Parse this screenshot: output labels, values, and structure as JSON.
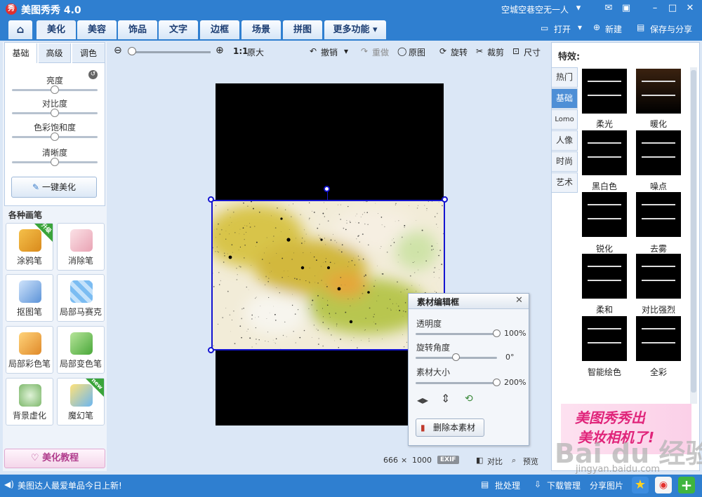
{
  "app": {
    "title": "美图秀秀 4.0",
    "logo_char": "秀"
  },
  "account": {
    "name": "空城空巷空无一人"
  },
  "tabs": [
    {
      "label": "美化"
    },
    {
      "label": "美容"
    },
    {
      "label": "饰品"
    },
    {
      "label": "文字"
    },
    {
      "label": "边框"
    },
    {
      "label": "场景"
    },
    {
      "label": "拼图"
    },
    {
      "label": "更多功能 ▾"
    }
  ],
  "top_actions": {
    "open": "打开",
    "new": "新建",
    "save_share": "保存与分享"
  },
  "left": {
    "subtabs": [
      "基础",
      "高级",
      "调色"
    ],
    "sliders": [
      {
        "label": "亮度",
        "level": 0.5
      },
      {
        "label": "对比度",
        "level": 0.5
      },
      {
        "label": "色彩饱和度",
        "level": 0.5
      },
      {
        "label": "清晰度",
        "level": 0.5
      }
    ],
    "one_click": "一键美化",
    "brushes_title": "各种画笔",
    "brushes": [
      {
        "label": "涂鸦笔",
        "badge": "升级"
      },
      {
        "label": "消除笔",
        "badge": ""
      },
      {
        "label": "抠图笔",
        "badge": ""
      },
      {
        "label": "局部马赛克",
        "badge": ""
      },
      {
        "label": "局部彩色笔",
        "badge": ""
      },
      {
        "label": "局部变色笔",
        "badge": ""
      },
      {
        "label": "背景虚化",
        "badge": ""
      },
      {
        "label": "魔幻笔",
        "badge": "new"
      }
    ],
    "tutorial": "美化教程"
  },
  "toolbar": {
    "ratio": "1:1",
    "original_size": "原大",
    "undo": "撤销",
    "redo": "重做",
    "original": "原图",
    "rotate": "旋转",
    "crop": "裁剪",
    "size": "尺寸"
  },
  "editor": {
    "title": "素材编辑框",
    "opacity_label": "透明度",
    "opacity_value": "100%",
    "opacity_level": 1.0,
    "rotation_label": "旋转角度",
    "rotation_value": "0°",
    "rotation_level": 0.5,
    "size_label": "素材大小",
    "size_value": "200%",
    "size_level": 1.0,
    "delete": "删除本素材"
  },
  "right": {
    "title": "特效:",
    "categories": [
      "热门",
      "基础",
      "Lomo",
      "人像",
      "时尚",
      "艺术"
    ],
    "effects": [
      "柔光",
      "暖化",
      "黑白色",
      "噪点",
      "锐化",
      "去雾",
      "柔和",
      "对比强烈",
      "智能绘色",
      "全彩"
    ],
    "ad_line1": "美图秀秀出",
    "ad_line2": "美妆相机了!"
  },
  "bottom": {
    "width": "666",
    "times": "×",
    "height": "1000",
    "exif": "EXIF",
    "compare": "对比",
    "preview": "预览"
  },
  "status": {
    "news": "美图达人最爱单品今日上新!",
    "batch": "批处理",
    "download": "下载管理",
    "share": "分享图片"
  },
  "watermark": {
    "text": "Bai du 经验",
    "url": "jingyan.baidu.com"
  }
}
